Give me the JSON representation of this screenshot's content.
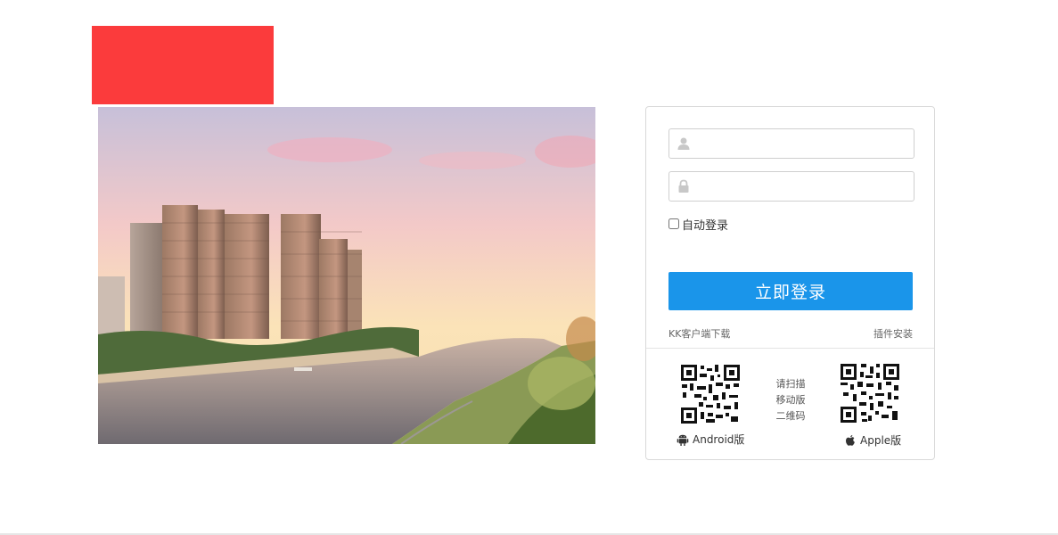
{
  "login": {
    "username_placeholder": "",
    "password_placeholder": "",
    "remember_label": "自动登录",
    "submit_label": "立即登录",
    "client_download": "KK客户端下载",
    "plugin_install": "插件安装"
  },
  "mobile": {
    "scan_lines": [
      "请扫描",
      "移动版",
      "二维码"
    ],
    "android_label": "Android版",
    "apple_label": "Apple版"
  },
  "colors": {
    "logo": "#fb3b3c",
    "primary_button": "#1a95ea"
  },
  "icons": {
    "username": "user-icon",
    "password": "lock-icon",
    "android": "android-icon",
    "apple": "apple-icon"
  }
}
